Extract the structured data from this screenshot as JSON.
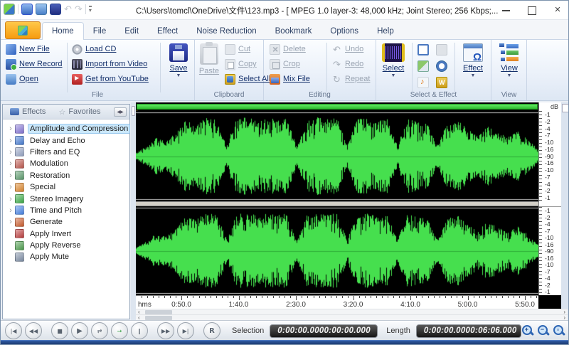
{
  "window": {
    "title": "C:\\Users\\tomcl\\OneDrive\\文件\\123.mp3 - [ MPEG 1.0 layer-3: 48,000 kHz; Joint Stereo; 256 Kbps;..."
  },
  "tabs": {
    "active": "Home",
    "items": [
      "Home",
      "File",
      "Edit",
      "Effect",
      "Noise Reduction",
      "Bookmark",
      "Options",
      "Help"
    ]
  },
  "ribbon": {
    "groups": {
      "file": {
        "label": "File",
        "col1": [
          {
            "label": "New File",
            "icon": "new-file"
          },
          {
            "label": "New Record",
            "icon": "new-record"
          },
          {
            "label": "Open",
            "icon": "open"
          }
        ],
        "col2": [
          {
            "label": "Load CD",
            "icon": "load-cd"
          },
          {
            "label": "Import from Video",
            "icon": "import-video"
          },
          {
            "label": "Get from YouTube",
            "icon": "youtube"
          }
        ],
        "big": {
          "label": "Save"
        }
      },
      "clipboard": {
        "label": "Clipboard",
        "big": {
          "label": "Paste",
          "disabled": true
        },
        "col": [
          {
            "label": "Cut",
            "icon": "cut",
            "disabled": true
          },
          {
            "label": "Copy",
            "icon": "copy",
            "disabled": true
          },
          {
            "label": "Select All",
            "icon": "select-all",
            "disabled": false
          }
        ]
      },
      "editing": {
        "label": "Editing",
        "col1": [
          {
            "label": "Delete",
            "icon": "delete",
            "disabled": true
          },
          {
            "label": "Crop",
            "icon": "crop",
            "disabled": true
          },
          {
            "label": "Mix File",
            "icon": "mix-file",
            "disabled": false
          }
        ],
        "col2": [
          {
            "label": "Undo",
            "icon": "undo",
            "glyph": "↶",
            "disabled": true
          },
          {
            "label": "Redo",
            "icon": "redo",
            "glyph": "↷",
            "disabled": true
          },
          {
            "label": "Repeat",
            "icon": "repeat",
            "glyph": "↻",
            "disabled": true
          }
        ]
      },
      "select_effect": {
        "label": "Select & Effect",
        "select_big": {
          "label": "Select"
        },
        "effect_big": {
          "label": "Effect"
        }
      },
      "view": {
        "label": "View",
        "big": {
          "label": "View"
        }
      }
    }
  },
  "sidebar": {
    "tabs": [
      {
        "label": "Effects"
      },
      {
        "label": "Favorites"
      }
    ],
    "tree": [
      {
        "label": "Amplitude and Compression",
        "selected": true,
        "expandable": true,
        "color": "#8878d8"
      },
      {
        "label": "Delay and Echo",
        "selected": false,
        "expandable": true,
        "color": "#4a7fd6"
      },
      {
        "label": "Filters and EQ",
        "selected": false,
        "expandable": true,
        "color": "#9aa8c8"
      },
      {
        "label": "Modulation",
        "selected": false,
        "expandable": true,
        "color": "#c05a50"
      },
      {
        "label": "Restoration",
        "selected": false,
        "expandable": true,
        "color": "#5f9e6f"
      },
      {
        "label": "Special",
        "selected": false,
        "expandable": true,
        "color": "#e08a30"
      },
      {
        "label": "Stereo Imagery",
        "selected": false,
        "expandable": true,
        "color": "#3fae4a"
      },
      {
        "label": "Time and Pitch",
        "selected": false,
        "expandable": true,
        "color": "#4a86e8"
      },
      {
        "label": "Generate",
        "selected": false,
        "expandable": true,
        "color": "#d06030"
      },
      {
        "label": "Apply Invert",
        "selected": false,
        "expandable": false,
        "color": "#c04040"
      },
      {
        "label": "Apply Reverse",
        "selected": false,
        "expandable": false,
        "color": "#50a050"
      },
      {
        "label": "Apply Mute",
        "selected": false,
        "expandable": false,
        "color": "#8090a8"
      }
    ]
  },
  "waveform": {
    "db_unit": "dB",
    "db_labels": [
      "-1",
      "-2",
      "-4",
      "-7",
      "-10",
      "-16",
      "-90",
      "-16",
      "-10",
      "-7",
      "-4",
      "-2",
      "-1"
    ],
    "timeline_unit": "hms",
    "timeline_labels": [
      "0:50.0",
      "1:40.0",
      "2:30.0",
      "3:20.0",
      "4:10.0",
      "5:00.0",
      "5:50.0"
    ],
    "wave_color": "#46df4e"
  },
  "transport": {
    "buttons": [
      {
        "name": "skip-start-button",
        "glyph": "|◀",
        "group": false
      },
      {
        "name": "rewind-button",
        "glyph": "◀◀",
        "group": false
      },
      {
        "name": "stop-button",
        "glyph": "■",
        "group": true
      },
      {
        "name": "play-button",
        "glyph": "▶",
        "group": false
      },
      {
        "name": "shuttle-button",
        "glyph": "⇄",
        "group": false
      },
      {
        "name": "play-all-button",
        "glyph": "→",
        "group": false,
        "color": "#2f9e3f"
      },
      {
        "name": "pause-button",
        "glyph": "‖",
        "group": false
      },
      {
        "name": "fast-forward-button",
        "glyph": "▶▶",
        "group": true
      },
      {
        "name": "skip-end-button",
        "glyph": "▶|",
        "group": false
      },
      {
        "name": "record-button",
        "glyph": "R",
        "group": true
      }
    ],
    "selection_label": "Selection",
    "selection_values": [
      "0:00:00.000",
      "0:00:00.000"
    ],
    "length_label": "Length",
    "length_values": [
      "0:00:00.000",
      "0:06:06.000"
    ],
    "zoom_buttons": [
      {
        "name": "zoom-in-button",
        "mark": "+"
      },
      {
        "name": "zoom-out-button",
        "mark": "−"
      },
      {
        "name": "zoom-selection-button",
        "mark": "▫"
      },
      {
        "name": "zoom-full-button",
        "mark": "◄"
      },
      {
        "name": "zoom-vertical-in-button",
        "mark": "+"
      },
      {
        "name": "zoom-vertical-out-button",
        "mark": "−"
      }
    ]
  }
}
